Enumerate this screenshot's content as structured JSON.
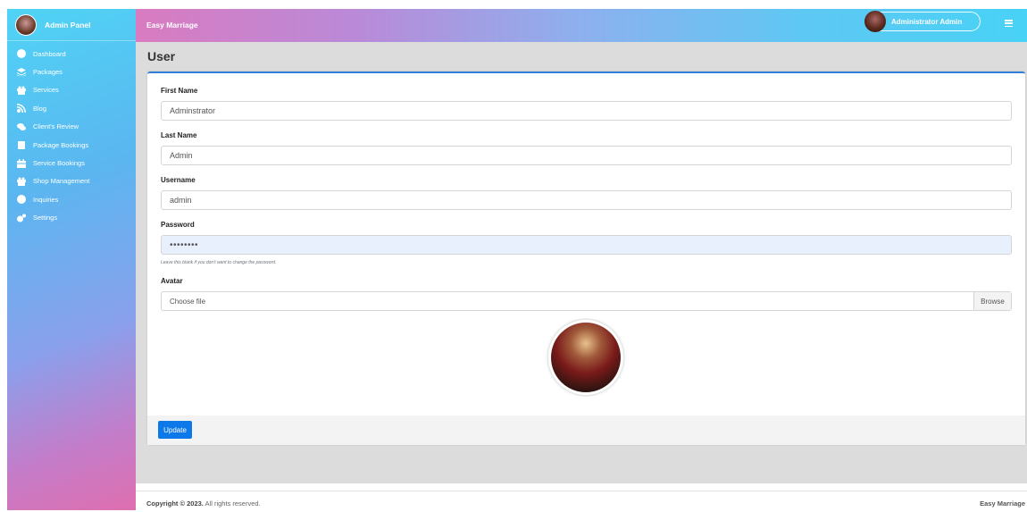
{
  "sidebar": {
    "brand": "Admin Panel",
    "items": [
      {
        "label": "Dashboard",
        "icon": "dashboard-icon"
      },
      {
        "label": "Packages",
        "icon": "layers-icon"
      },
      {
        "label": "Services",
        "icon": "gift-icon"
      },
      {
        "label": "Blog",
        "icon": "blog-icon"
      },
      {
        "label": "Client's Review",
        "icon": "comments-icon"
      },
      {
        "label": "Package Bookings",
        "icon": "clipboard-icon"
      },
      {
        "label": "Service Bookings",
        "icon": "calendar-icon"
      },
      {
        "label": "Shop Management",
        "icon": "gift-icon"
      },
      {
        "label": "Inquiries",
        "icon": "question-icon"
      },
      {
        "label": "Settings",
        "icon": "cogs-icon"
      }
    ]
  },
  "topbar": {
    "title": "Easy Marriage",
    "user_name": "Administrator Admin"
  },
  "page": {
    "title": "User"
  },
  "form": {
    "first_name": {
      "label": "First Name",
      "value": "Adminstrator"
    },
    "last_name": {
      "label": "Last Name",
      "value": "Admin"
    },
    "username": {
      "label": "Username",
      "value": "admin"
    },
    "password": {
      "label": "Password",
      "value": "••••••••",
      "hint": "Leave this blank if you don't want to change the password."
    },
    "avatar": {
      "label": "Avatar",
      "placeholder": "Choose file",
      "browse": "Browse"
    },
    "update_button": "Update"
  },
  "footer": {
    "copyright_prefix": "Copyright © 2023.",
    "copyright_suffix": " All rights reserved.",
    "brand": "Easy Marriage"
  },
  "colors": {
    "accent": "#0d79e8",
    "card_border": "#2f7fd8"
  }
}
